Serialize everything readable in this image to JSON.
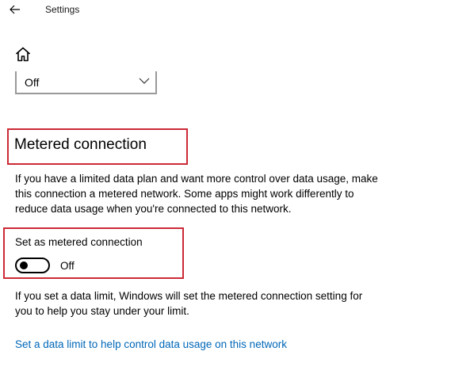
{
  "window": {
    "title": "Settings",
    "back_icon": "arrow-left-icon",
    "home_icon": "home-icon"
  },
  "dropdown": {
    "value": "Off",
    "icon": "chevron-down-icon"
  },
  "metered": {
    "title": "Metered connection",
    "description": "If you have a limited data plan and want more control over data usage, make this connection a metered network. Some apps might work differently to reduce data usage when you're connected to this network.",
    "toggle_label": "Set as metered connection",
    "toggle_state": "Off",
    "toggle_on": false,
    "info": "If you set a data limit, Windows will set the metered connection setting for you to help you stay under your limit.",
    "link": "Set a data limit to help control data usage on this network"
  },
  "colors": {
    "highlight_border": "#cc2a36",
    "link": "#0067b8",
    "dropdown_border": "#999999"
  }
}
